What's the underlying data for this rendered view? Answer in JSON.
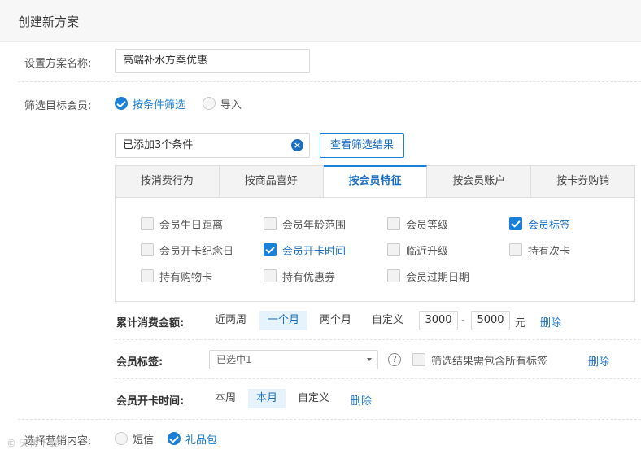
{
  "header": {
    "title": "创建新方案"
  },
  "plan_name": {
    "label": "设置方案名称:",
    "value": "高端补水方案优惠"
  },
  "target": {
    "label": "筛选目标会员:",
    "options": [
      {
        "label": "按条件筛选",
        "selected": true
      },
      {
        "label": "导入",
        "selected": false
      }
    ]
  },
  "conditions": {
    "summary": "已添加3个条件",
    "clear_glyph": "×",
    "view_button": "查看筛选结果"
  },
  "tabs": [
    {
      "label": "按消费行为",
      "active": false
    },
    {
      "label": "按商品喜好",
      "active": false
    },
    {
      "label": "按会员特征",
      "active": true
    },
    {
      "label": "按会员账户",
      "active": false
    },
    {
      "label": "按卡券购销",
      "active": false
    }
  ],
  "features": [
    {
      "label": "会员生日距离",
      "checked": false
    },
    {
      "label": "会员年龄范围",
      "checked": false
    },
    {
      "label": "会员等级",
      "checked": false
    },
    {
      "label": "会员标签",
      "checked": true
    },
    {
      "label": "会员开卡纪念日",
      "checked": false
    },
    {
      "label": "会员开卡时间",
      "checked": true
    },
    {
      "label": "临近升级",
      "checked": false
    },
    {
      "label": "持有次卡",
      "checked": false
    },
    {
      "label": "持有购物卡",
      "checked": false
    },
    {
      "label": "持有优惠券",
      "checked": false
    },
    {
      "label": "会员过期日期",
      "checked": false
    }
  ],
  "spending": {
    "label": "累计消费金额:",
    "options": [
      {
        "label": "近两周",
        "active": false
      },
      {
        "label": "一个月",
        "active": true
      },
      {
        "label": "两个月",
        "active": false
      },
      {
        "label": "自定义",
        "active": false
      }
    ],
    "min": "3000",
    "separator": "-",
    "max": "5000",
    "unit": "元",
    "delete": "删除"
  },
  "tag": {
    "label": "会员标签:",
    "selected": "已选中1",
    "help_glyph": "?",
    "include_all_label": "筛选结果需包含所有标签",
    "include_all_checked": false,
    "delete": "删除"
  },
  "open_time": {
    "label": "会员开卡时间:",
    "options": [
      {
        "label": "本周",
        "active": false
      },
      {
        "label": "本月",
        "active": true
      },
      {
        "label": "自定义",
        "active": false
      }
    ],
    "delete": "删除"
  },
  "marketing": {
    "label": "选择营销内容:",
    "options": [
      {
        "label": "短信",
        "selected": false
      },
      {
        "label": "礼品包",
        "selected": true
      }
    ]
  },
  "watermark": "© 天极下载",
  "colors": {
    "accent": "#1a7fd6",
    "link": "#1a6fc2",
    "header_bg": "#f7f7f7"
  }
}
